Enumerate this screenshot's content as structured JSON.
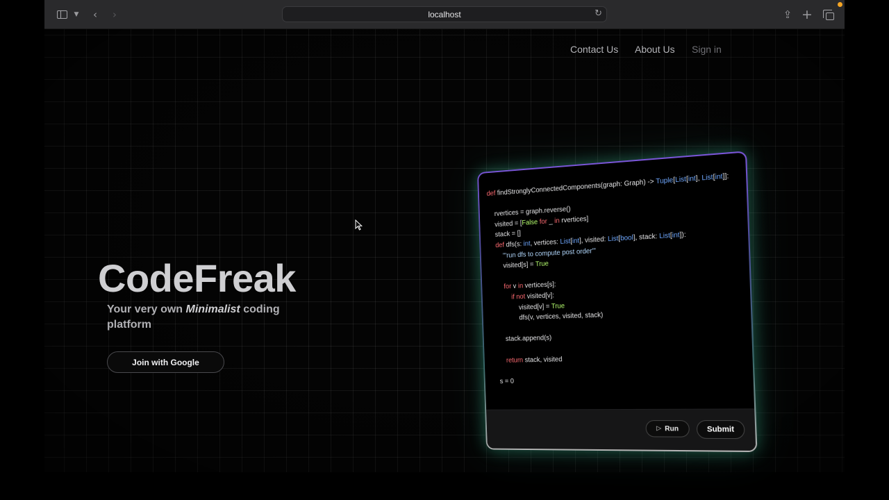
{
  "browser": {
    "url": "localhost"
  },
  "nav": {
    "contact": "Contact Us",
    "about": "About Us",
    "signin": "Sign in"
  },
  "hero": {
    "title": "CodeFreak",
    "subtitle_pre": "Your very own ",
    "subtitle_em": "Minimalist",
    "subtitle_post": " coding platform",
    "cta": "Join with Google"
  },
  "editor": {
    "lines": [
      "def findStronglyConnectedComponents(graph: Graph) -> Tuple[List[int], List[int]]:",
      "",
      "    rvertices = graph.reverse()",
      "    visited = [False for _ in rvertices]",
      "    stack = []",
      "    def dfs(s: int, vertices: List[int], visited: List[bool], stack: List[int]):",
      "        '''run dfs to compute post order'''",
      "        visited[s] = True",
      "",
      "        for v in vertices[s]:",
      "            if not visited[v]:",
      "                visited[v] = True",
      "                dfs(v, vertices, visited, stack)",
      "",
      "        stack.append(s)",
      "",
      "        return stack, visited",
      "",
      "    s = 0"
    ],
    "run_label": "Run",
    "submit_label": "Submit"
  },
  "colors": {
    "keyword": "#ff6b72",
    "type": "#6fa8ff",
    "literal": "#b7ff6f",
    "docstring": "#b3d9ff",
    "glow": "#46e6b4",
    "card_border_top": "#7a55d8"
  }
}
